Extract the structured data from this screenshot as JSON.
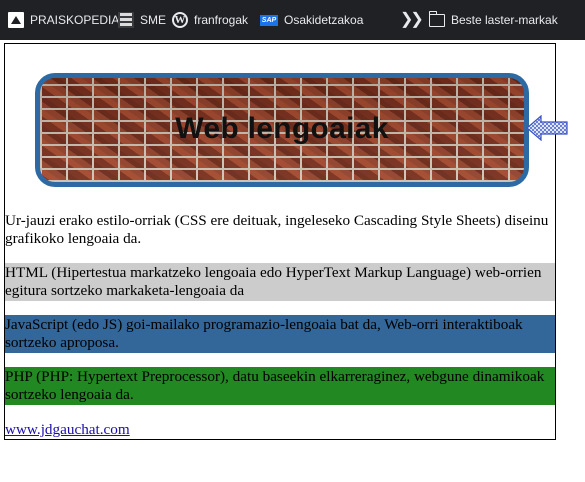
{
  "bookmarks_bar": {
    "items": [
      {
        "label": "PRAISKOPEDIA",
        "icon": "praiskopedia-icon"
      },
      {
        "label": "SME",
        "icon": "sme-icon"
      },
      {
        "label": "franfrogak",
        "icon": "wordpress-icon"
      },
      {
        "label": "Osakidetzakoa",
        "icon": "sap-icon"
      }
    ],
    "overflow_icon": "chevron-double-right-icon",
    "other_bookmarks_label": "Beste laster-markak"
  },
  "banner": {
    "title": "Web lengoaiak",
    "border_color": "#2d6aa3"
  },
  "content": {
    "paragraphs": [
      {
        "text": "Ur-jauzi erako estilo-orriak (CSS ere deituak, ingeleseko Cascading Style Sheets) diseinu grafikoko lengoaia da.",
        "background": "#ffffff"
      },
      {
        "text": "HTML (Hipertestua markatzeko lengoaia edo HyperText Markup Language) web-orrien egitura sortzeko markaketa-lengoaia da",
        "background": "#cccccc"
      },
      {
        "text": "JavaScript (edo JS) goi-mailako programazio-lengoaia bat da, Web-orri interaktiboak sortzeko aproposa.",
        "background": "#336699"
      },
      {
        "text": "PHP (PHP: Hypertext Preprocessor), datu baseekin elkarreraginez, webgune dinamikoak sortzeko lengoaia da.",
        "background": "#228822"
      }
    ],
    "link_text": "www.jdgauchat.com"
  },
  "colors": {
    "toolbar_bg": "#202124",
    "link": "#1a0dab"
  }
}
